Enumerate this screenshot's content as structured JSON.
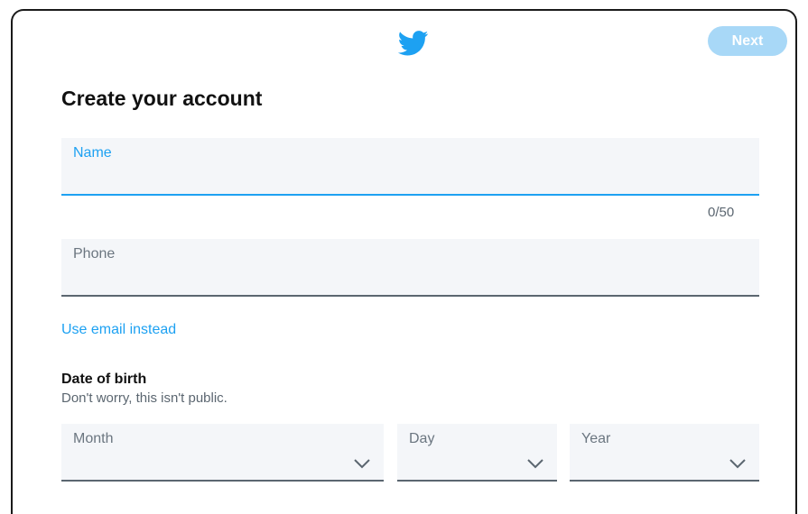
{
  "header": {
    "logo_icon": "twitter-bird-icon",
    "next_label": "Next",
    "brand_color": "#1da1f2",
    "next_bg": "#a8d8f7"
  },
  "title": "Create your account",
  "name_field": {
    "label": "Name",
    "value": "",
    "counter": "0/50"
  },
  "phone_field": {
    "label": "Phone",
    "value": ""
  },
  "email_link": "Use email instead",
  "dob": {
    "title": "Date of birth",
    "subtitle": "Don't worry, this isn't public.",
    "month_label": "Month",
    "day_label": "Day",
    "year_label": "Year",
    "chevron_icon": "chevron-down-icon"
  }
}
